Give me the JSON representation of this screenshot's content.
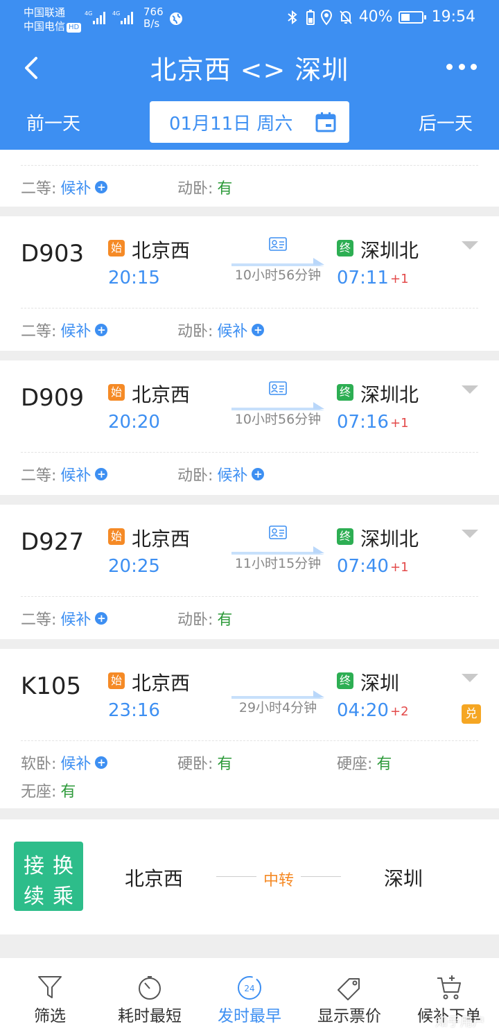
{
  "status_bar": {
    "carrier1": "中国联通",
    "carrier2": "中国电信",
    "hd": "HD",
    "net_speed_value": "766",
    "net_speed_unit": "B/s",
    "battery": "40%",
    "time": "19:54"
  },
  "header": {
    "title": "北京西 <> 深圳",
    "prev_day": "前一天",
    "next_day": "后一天",
    "date": "01月11日 周六"
  },
  "partial_train": {
    "seats": [
      {
        "label": "二等:",
        "status": "候补",
        "type": "wait"
      },
      {
        "label": "动卧:",
        "status": "有",
        "type": "avail"
      }
    ]
  },
  "trains": [
    {
      "number": "D903",
      "start_tag": "始",
      "end_tag": "终",
      "from": "北京西",
      "to": "深圳北",
      "dep": "20:15",
      "arr": "07:11",
      "day_plus": "+1",
      "duration": "10小时56分钟",
      "id_icon": true,
      "seats": [
        {
          "label": "二等:",
          "status": "候补",
          "type": "wait"
        },
        {
          "label": "动卧:",
          "status": "候补",
          "type": "wait"
        }
      ]
    },
    {
      "number": "D909",
      "start_tag": "始",
      "end_tag": "终",
      "from": "北京西",
      "to": "深圳北",
      "dep": "20:20",
      "arr": "07:16",
      "day_plus": "+1",
      "duration": "10小时56分钟",
      "id_icon": true,
      "seats": [
        {
          "label": "二等:",
          "status": "候补",
          "type": "wait"
        },
        {
          "label": "动卧:",
          "status": "候补",
          "type": "wait"
        }
      ]
    },
    {
      "number": "D927",
      "start_tag": "始",
      "end_tag": "终",
      "from": "北京西",
      "to": "深圳北",
      "dep": "20:25",
      "arr": "07:40",
      "day_plus": "+1",
      "duration": "11小时15分钟",
      "id_icon": true,
      "seats": [
        {
          "label": "二等:",
          "status": "候补",
          "type": "wait"
        },
        {
          "label": "动卧:",
          "status": "有",
          "type": "avail"
        }
      ]
    },
    {
      "number": "K105",
      "start_tag": "始",
      "end_tag": "终",
      "from": "北京西",
      "to": "深圳",
      "dep": "23:16",
      "arr": "04:20",
      "day_plus": "+2",
      "duration": "29小时4分钟",
      "id_icon": false,
      "exchange_badge": "兑",
      "seats": [
        {
          "label": "软卧:",
          "status": "候补",
          "type": "wait"
        },
        {
          "label": "硬卧:",
          "status": "有",
          "type": "avail"
        },
        {
          "label": "硬座:",
          "status": "有",
          "type": "avail"
        },
        {
          "label": "无座:",
          "status": "有",
          "type": "avail"
        }
      ]
    }
  ],
  "transfer": {
    "badge": [
      "接",
      "换",
      "续",
      "乘"
    ],
    "from": "北京西",
    "middle": "中转",
    "to": "深圳"
  },
  "bottom_tabs": [
    {
      "label": "筛选",
      "icon": "filter-icon"
    },
    {
      "label": "耗时最短",
      "icon": "stopwatch-icon"
    },
    {
      "label": "发时最早",
      "icon": "clock-24-icon",
      "active": true
    },
    {
      "label": "显示票价",
      "icon": "price-tag-icon"
    },
    {
      "label": "候补下单",
      "icon": "cart-plus-icon"
    }
  ],
  "watermark": "知乎用户",
  "colors": {
    "brand_blue": "#3d8ff2",
    "available_green": "#2d9a3a",
    "start_orange": "#f58a26",
    "end_green": "#2dae53",
    "day_plus_red": "#e34a4a",
    "transfer_green": "#2dbd8a"
  }
}
